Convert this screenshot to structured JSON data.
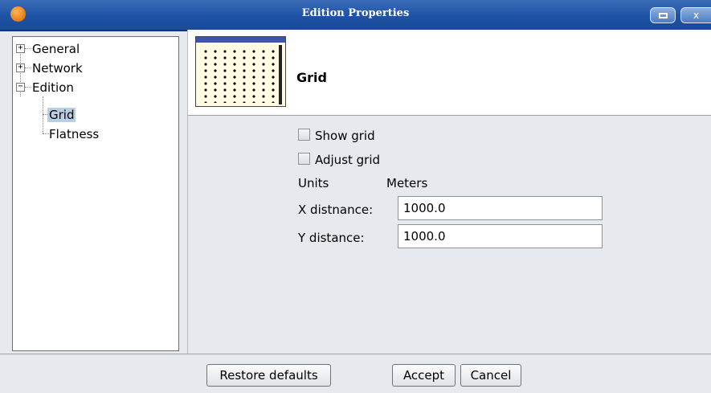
{
  "window": {
    "title": "Edition Properties",
    "minimize_symbol": "",
    "close_symbol": "x"
  },
  "tree": {
    "items": [
      {
        "label": "General",
        "expander": "+"
      },
      {
        "label": "Network",
        "expander": "+"
      },
      {
        "label": "Edition",
        "expander": "−"
      },
      {
        "label": "Grid",
        "selected": true
      },
      {
        "label": "Flatness"
      }
    ]
  },
  "header": {
    "title": "Grid",
    "image_icon": "grid-preview-icon"
  },
  "form": {
    "show_grid_label": "Show grid",
    "show_grid_checked": false,
    "adjust_grid_label": "Adjust grid",
    "adjust_grid_checked": false,
    "units_label": "Units",
    "units_value": "Meters",
    "x_distance_label": "X distnance:",
    "x_distance_value": "1000.0",
    "y_distance_label": "Y distance:",
    "y_distance_value": "1000.0"
  },
  "footer": {
    "restore_label": "Restore defaults",
    "accept_label": "Accept",
    "cancel_label": "Cancel"
  },
  "colors": {
    "title_bar": "#1e52a4",
    "selection": "#b8cfe5",
    "background": "#e6e9ee"
  }
}
